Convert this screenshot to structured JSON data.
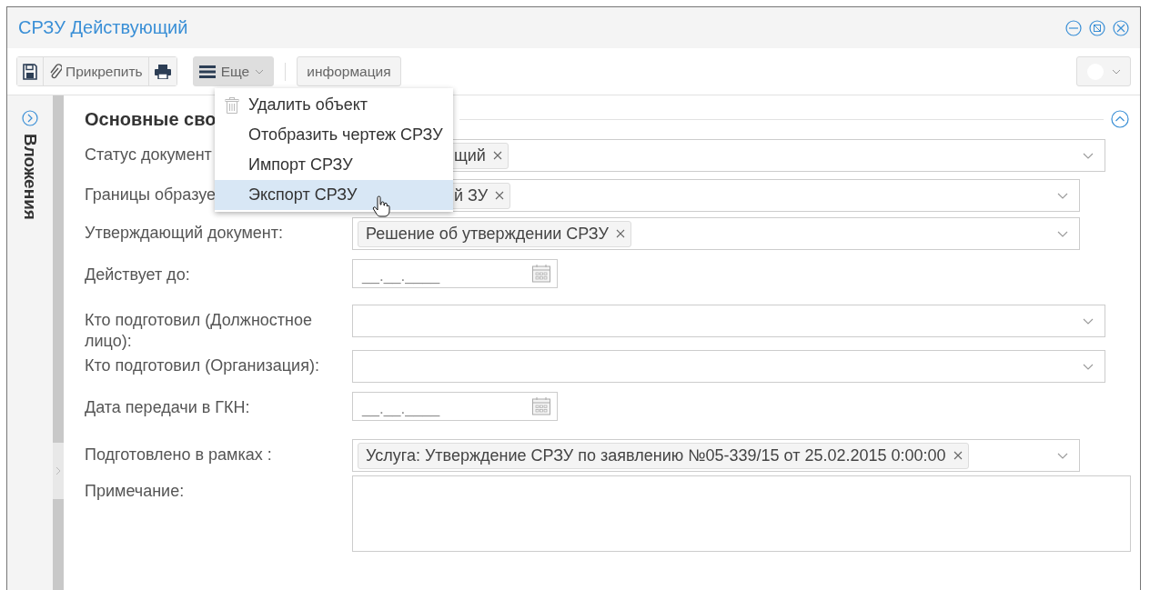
{
  "window": {
    "title": "СРЗУ Действующий"
  },
  "toolbar": {
    "buttons": [
      {
        "kind": "save"
      },
      {
        "kind": "attach",
        "label": "Прикрепить"
      },
      {
        "kind": "print"
      }
    ],
    "more": {
      "label": "Еще",
      "expanded": true
    },
    "info": {
      "label": "информация"
    }
  },
  "menu": [
    {
      "label": "Удалить объект",
      "kind": "delete",
      "selected": false
    },
    {
      "label": "Отобразить чертеж СРЗУ",
      "kind": "plain",
      "selected": false
    },
    {
      "label": "Импорт СРЗУ",
      "kind": "plain",
      "selected": false
    },
    {
      "label": "Экспорт СРЗУ",
      "kind": "plain",
      "selected": true
    }
  ],
  "sidebar": {
    "label": "Вложения"
  },
  "section": {
    "title": "Основные сво",
    "expanded": true
  },
  "fields": [
    {
      "label": "Статус документ",
      "kind": "select",
      "token": "щий",
      "covered": true
    },
    {
      "label": "Границы образуе",
      "kind": "select",
      "token": "й ЗУ",
      "covered": true
    },
    {
      "label": "Утверждающий документ:",
      "kind": "select",
      "token": "Решение об утверждении СРЗУ",
      "covered": false
    },
    {
      "label": "Действует до:",
      "kind": "date",
      "value": "__.__.____"
    },
    {
      "label": "Кто подготовил (Должностное лицо):",
      "kind": "select"
    },
    {
      "label": "Кто подготовил (Организация):",
      "kind": "select"
    },
    {
      "label": "Дата передачи в ГКН:",
      "kind": "date",
      "value": "__.__.____"
    },
    {
      "label": "Подготовлено в рамках :",
      "kind": "select",
      "token": "Услуга: Утверждение СРЗУ по заявлению №05-339/15 от 25.02.2015 0:00:00",
      "covered": false
    },
    {
      "label": "Примечание:",
      "kind": "textarea"
    }
  ]
}
